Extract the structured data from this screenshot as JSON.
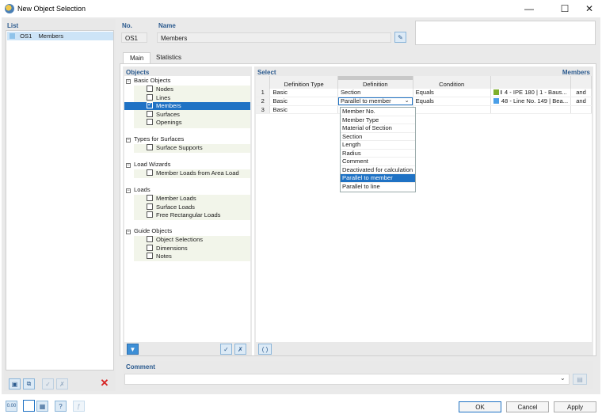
{
  "window": {
    "title": "New Object Selection"
  },
  "list": {
    "header": "List",
    "items": [
      {
        "id": "OS1",
        "name": "Members"
      }
    ]
  },
  "number": {
    "label": "No.",
    "value": "OS1"
  },
  "name": {
    "label": "Name",
    "value": "Members"
  },
  "tabs": [
    "Main",
    "Statistics"
  ],
  "objects": {
    "header": "Objects",
    "groups": [
      {
        "label": "Basic Objects",
        "items": [
          "Nodes",
          "Lines",
          "Members",
          "Surfaces",
          "Openings"
        ]
      },
      {
        "label": "Types for Surfaces",
        "items": [
          "Surface Supports"
        ]
      },
      {
        "label": "Load Wizards",
        "items": [
          "Member Loads from Area Load"
        ]
      },
      {
        "label": "Loads",
        "items": [
          "Member Loads",
          "Surface Loads",
          "Free Rectangular Loads"
        ]
      },
      {
        "label": "Guide Objects",
        "items": [
          "Object Selections",
          "Dimensions",
          "Notes"
        ]
      }
    ],
    "checked": "Members"
  },
  "select": {
    "header": "Select",
    "type_label": "Members",
    "columns": [
      "Definition Type",
      "Definition",
      "Condition"
    ],
    "rows": [
      {
        "n": "1",
        "type": "Basic",
        "definition": "Section",
        "condition": "Equals",
        "value": "4 - IPE 180 | 1 - Baus...",
        "value_icon": "I-section-icon",
        "value_color": "#7fb02a",
        "logic": "and"
      },
      {
        "n": "2",
        "type": "Basic",
        "definition": "Parallel to member",
        "condition": "Equals",
        "value": "48 - Line No. 149 | Bea...",
        "value_color": "#4a9fe8",
        "logic": "and"
      },
      {
        "n": "3",
        "type": "Basic",
        "definition": "",
        "condition": "",
        "value": "",
        "logic": ""
      }
    ],
    "dropdown_options": [
      "Member No.",
      "Member Type",
      "Material of Section",
      "Section",
      "Length",
      "Radius",
      "Comment",
      "Deactivated for calculation",
      "Parallel to member",
      "Parallel to line"
    ],
    "dropdown_selected": "Parallel to member",
    "bracket_button": "( )"
  },
  "comment": {
    "label": "Comment",
    "value": ""
  },
  "buttons": {
    "ok": "OK",
    "cancel": "Cancel",
    "apply": "Apply"
  },
  "bottom_icons": [
    "units-icon",
    "view-icon",
    "model-icon",
    "help-icon",
    "formula-icon"
  ],
  "colors": {
    "accent": "#1f72c4",
    "header_text": "#2c5b8f",
    "delete": "#d62424"
  }
}
